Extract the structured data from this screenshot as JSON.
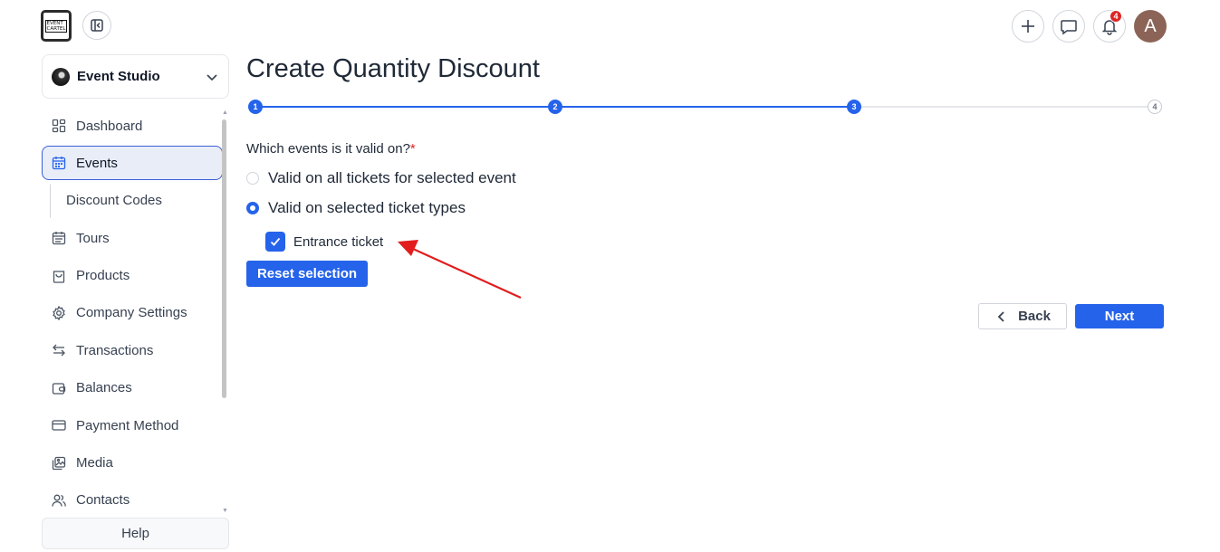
{
  "header": {
    "logo_line1": "EVENT",
    "logo_line2": "CARTEL",
    "notification_count": "4",
    "avatar_initial": "A"
  },
  "sidebar": {
    "org_name": "Event Studio",
    "items": [
      {
        "label": "Dashboard",
        "icon": "grid-icon"
      },
      {
        "label": "Events",
        "icon": "calendar-icon",
        "active": true
      },
      {
        "label": "Discount Codes",
        "sub": true
      },
      {
        "label": "Tours",
        "icon": "calendar-icon"
      },
      {
        "label": "Products",
        "icon": "shopping-bag-icon"
      },
      {
        "label": "Company Settings",
        "icon": "gear-icon"
      },
      {
        "label": "Transactions",
        "icon": "swap-arrows-icon"
      },
      {
        "label": "Balances",
        "icon": "wallet-icon"
      },
      {
        "label": "Payment Method",
        "icon": "credit-card-icon"
      },
      {
        "label": "Media",
        "icon": "images-icon"
      },
      {
        "label": "Contacts",
        "icon": "users-icon"
      }
    ],
    "help_label": "Help"
  },
  "main": {
    "title": "Create Quantity Discount",
    "stepper": {
      "steps": [
        "1",
        "2",
        "3",
        "4"
      ],
      "current_step": 3
    },
    "question_label": "Which events is it valid on?",
    "required_mark": "*",
    "options": [
      {
        "label": "Valid on all tickets for selected event",
        "selected": false
      },
      {
        "label": "Valid on selected ticket types",
        "selected": true
      }
    ],
    "ticket_types": [
      {
        "label": "Entrance ticket",
        "checked": true
      }
    ],
    "reset_label": "Reset selection",
    "back_label": "Back",
    "next_label": "Next"
  },
  "colors": {
    "primary": "#2563eb",
    "annotation_arrow": "#e11d1d",
    "required": "#dc2626"
  }
}
